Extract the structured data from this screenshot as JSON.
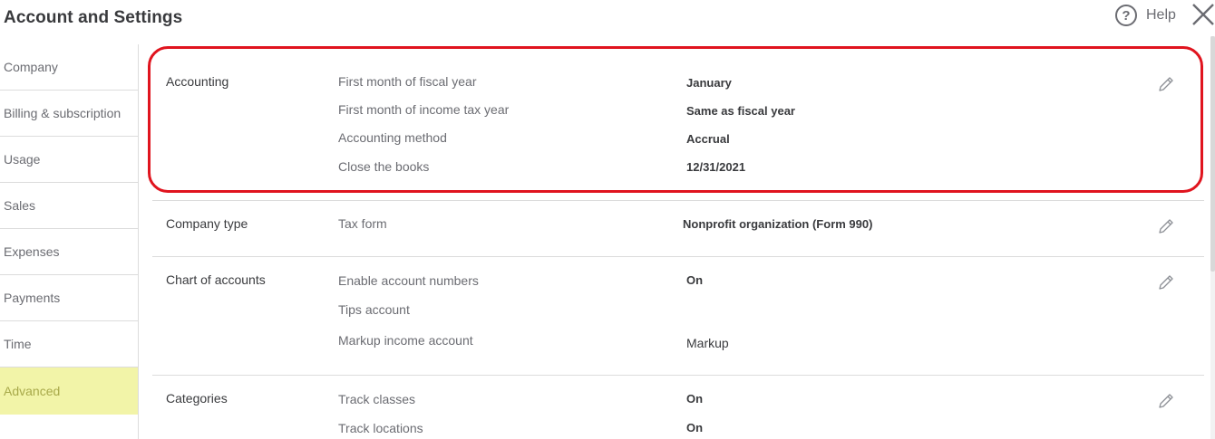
{
  "header": {
    "title": "Account and Settings",
    "help_label": "Help",
    "help_icon_glyph": "?"
  },
  "sidebar": {
    "items": [
      {
        "label": "Company"
      },
      {
        "label": "Billing & subscription"
      },
      {
        "label": "Usage"
      },
      {
        "label": "Sales"
      },
      {
        "label": "Expenses"
      },
      {
        "label": "Payments"
      },
      {
        "label": "Time"
      },
      {
        "label": "Advanced"
      }
    ],
    "active": "Advanced"
  },
  "sections": {
    "accounting": {
      "title": "Accounting",
      "rows": [
        {
          "label": "First month of fiscal year",
          "value": "January"
        },
        {
          "label": "First month of income tax year",
          "value": "Same as fiscal year"
        },
        {
          "label": "Accounting method",
          "value": "Accrual"
        },
        {
          "label": "Close the books",
          "value": "12/31/2021"
        }
      ]
    },
    "company_type": {
      "title": "Company type",
      "rows": [
        {
          "label": "Tax form",
          "value": "Nonprofit organization (Form 990)"
        }
      ]
    },
    "chart_of_accounts": {
      "title": "Chart of accounts",
      "rows": [
        {
          "label": "Enable account numbers",
          "value": "On"
        },
        {
          "label": "Tips account",
          "value": ""
        },
        {
          "label": "Markup income account",
          "value": "Markup"
        }
      ]
    },
    "categories": {
      "title": "Categories",
      "rows": [
        {
          "label": "Track classes",
          "value": "On"
        },
        {
          "label": "Track locations",
          "value": "On"
        }
      ]
    }
  },
  "colors": {
    "highlight_border": "#e0141e",
    "active_sidebar_bg": "#f2f4a8",
    "text_primary": "#393a3d",
    "text_secondary": "#6b6c72"
  },
  "icons": {
    "help": "help-circle-icon",
    "close": "close-icon",
    "edit": "pencil-icon"
  }
}
